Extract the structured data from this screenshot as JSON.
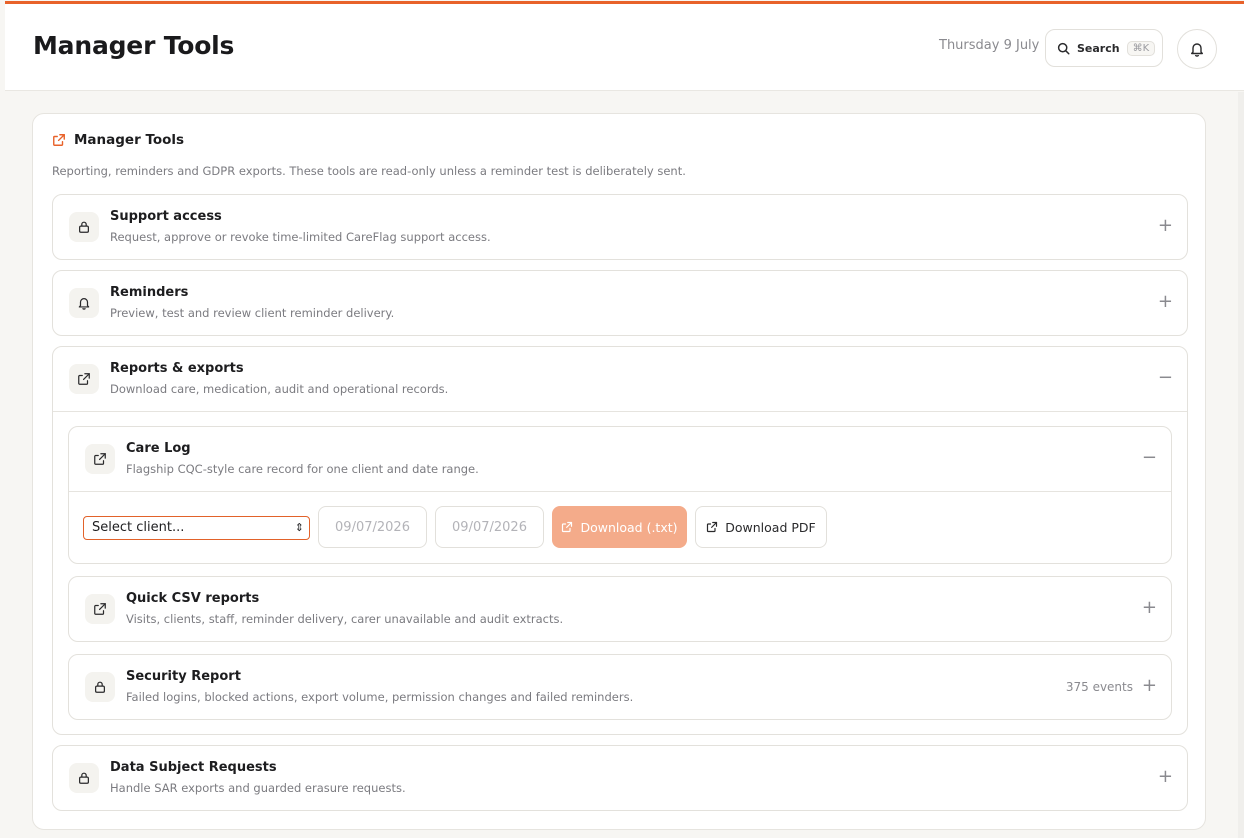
{
  "header": {
    "title": "Manager Tools",
    "date": "Thursday 9 July",
    "search_label": "Search",
    "search_shortcut": "⌘K"
  },
  "card": {
    "title": "Manager Tools",
    "description": "Reporting, reminders and GDPR exports. These tools are read-only unless a reminder test is deliberately sent."
  },
  "sections": {
    "support": {
      "title": "Support access",
      "description": "Request, approve or revoke time-limited CareFlag support access.",
      "toggle": "+"
    },
    "reminders": {
      "title": "Reminders",
      "description": "Preview, test and review client reminder delivery.",
      "toggle": "+"
    },
    "reports": {
      "title": "Reports & exports",
      "description": "Download care, medication, audit and operational records.",
      "toggle": "−"
    },
    "dsr": {
      "title": "Data Subject Requests",
      "description": "Handle SAR exports and guarded erasure requests.",
      "toggle": "+"
    }
  },
  "reports": {
    "care_log": {
      "title": "Care Log",
      "description": "Flagship CQC-style care record for one client and date range.",
      "toggle": "−",
      "client_select": "Select client...",
      "date_from": "09/07/2026",
      "date_to": "09/07/2026",
      "download_txt": "Download (.txt)",
      "download_pdf": "Download PDF"
    },
    "quick_csv": {
      "title": "Quick CSV reports",
      "description": "Visits, clients, staff, reminder delivery, carer unavailable and audit extracts.",
      "toggle": "+"
    },
    "security": {
      "title": "Security Report",
      "description": "Failed logins, blocked actions, export volume, permission changes and failed reminders.",
      "meta": "375 events",
      "toggle": "+"
    }
  },
  "colors": {
    "accent": "#e8622a",
    "disabled_button": "#f4ab8a"
  }
}
